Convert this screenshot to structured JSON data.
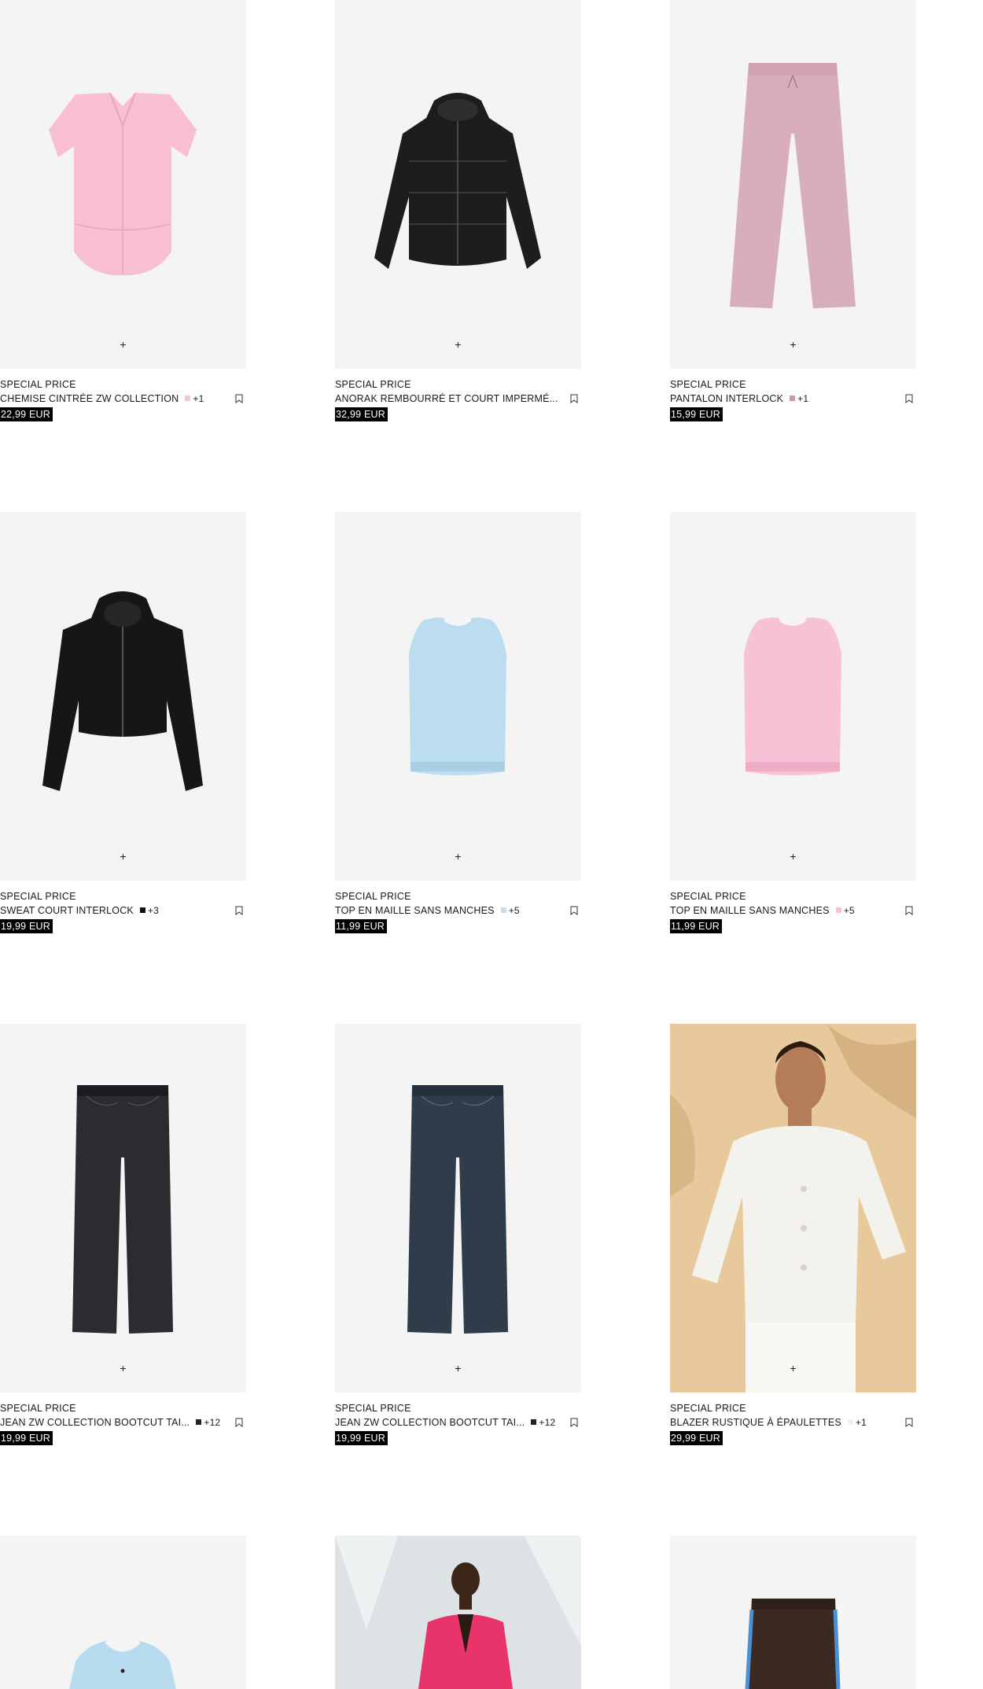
{
  "products": [
    {
      "tag": "SPECIAL PRICE",
      "name": "CHEMISE CINTRÉE ZW COLLECTION",
      "swatch": "#f5c7d4",
      "more": "+1",
      "price": "22,99 EUR",
      "icon": "pink-shirt-image"
    },
    {
      "tag": "SPECIAL PRICE",
      "name": "ANORAK REMBOURRÉ ET COURT IMPERMÉ...",
      "swatch": "",
      "more": "",
      "price": "32,99 EUR",
      "icon": "black-puffer-jacket-image"
    },
    {
      "tag": "SPECIAL PRICE",
      "name": "PANTALON INTERLOCK",
      "swatch": "#cc9aaa",
      "more": "+1",
      "price": "15,99 EUR",
      "icon": "pink-trousers-image"
    },
    {
      "tag": "SPECIAL PRICE",
      "name": "SWEAT COURT INTERLOCK",
      "swatch": "#111111",
      "more": "+3",
      "price": "19,99 EUR",
      "icon": "black-hoodie-image"
    },
    {
      "tag": "SPECIAL PRICE",
      "name": "TOP EN MAILLE SANS MANCHES",
      "swatch": "#c7dcef",
      "more": "+5",
      "price": "11,99 EUR",
      "icon": "blue-knit-top-image"
    },
    {
      "tag": "SPECIAL PRICE",
      "name": "TOP EN MAILLE SANS MANCHES",
      "swatch": "#f5c2d6",
      "more": "+5",
      "price": "11,99 EUR",
      "icon": "pink-knit-top-image"
    },
    {
      "tag": "SPECIAL PRICE",
      "name": "JEAN ZW COLLECTION BOOTCUT TAI...",
      "swatch": "#222222",
      "more": "+12",
      "price": "19,99 EUR",
      "icon": "black-jeans-image"
    },
    {
      "tag": "SPECIAL PRICE",
      "name": "JEAN ZW COLLECTION BOOTCUT TAI...",
      "swatch": "#222222",
      "more": "+12",
      "price": "19,99 EUR",
      "icon": "blue-jeans-image"
    },
    {
      "tag": "SPECIAL PRICE",
      "name": "BLAZER RUSTIQUE À ÉPAULETTES",
      "swatch": "#f2f0ea",
      "more": "+1",
      "price": "29,99 EUR",
      "icon": "model-white-blazer-image"
    },
    {
      "tag": "",
      "name": "",
      "swatch": "",
      "more": "",
      "price": "",
      "icon": "blue-cardigan-image"
    },
    {
      "tag": "",
      "name": "",
      "swatch": "",
      "more": "",
      "price": "",
      "icon": "model-pink-blazer-image"
    },
    {
      "tag": "",
      "name": "",
      "swatch": "",
      "more": "",
      "price": "",
      "icon": "brown-track-pants-image"
    }
  ],
  "quick_add_symbol": "+"
}
